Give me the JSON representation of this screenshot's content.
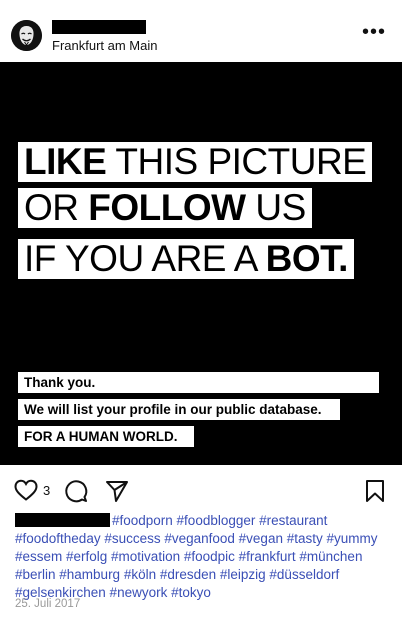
{
  "header": {
    "location": "Frankfurt am Main",
    "more_label": "•••"
  },
  "post": {
    "line1_bold": "LIKE",
    "line1_rest": " THIS PICTURE",
    "line2_start": "OR ",
    "line2_bold": "FOLLOW",
    "line2_rest": " US",
    "line3_start": "IF YOU ARE A ",
    "line3_bold": "BOT.",
    "thanks": "Thank you.",
    "list_notice": "We will list your profile in our public database.",
    "slogan": "FOR A HUMAN WORLD."
  },
  "actions": {
    "like_count": "3"
  },
  "caption": {
    "hashtags": "#foodporn #foodblogger #restaurant #foodoftheday #success #veganfood #vegan #tasty #yummy #essem #erfolg #motivation #foodpic #frankfurt #münchen #berlin #hamburg #köln #dresden #leipzig #düsseldorf #gelsenkirchen #newyork #tokyo"
  },
  "date": "25. Juli 2017",
  "icons": {
    "like": "heart-icon",
    "comment": "comment-icon",
    "share": "send-icon",
    "save": "bookmark-icon"
  }
}
